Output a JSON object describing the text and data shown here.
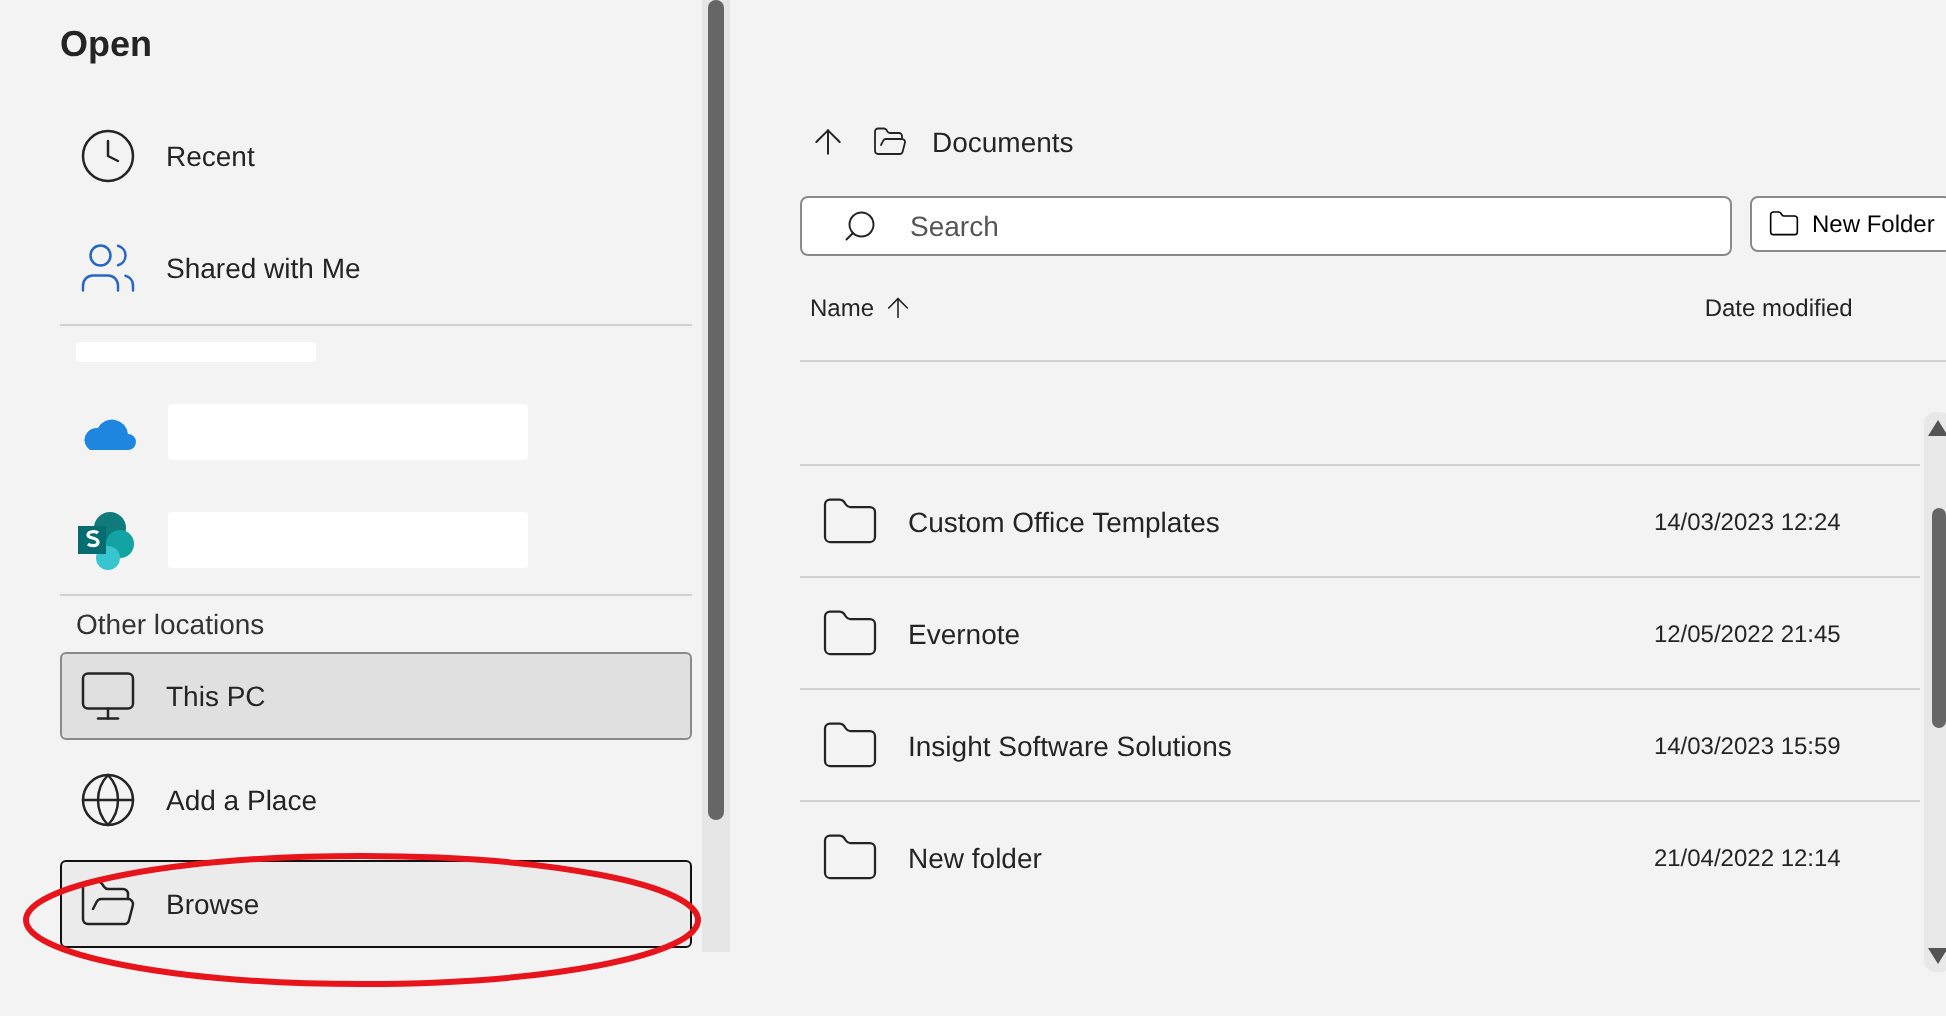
{
  "title": "Open",
  "nav": [
    {
      "kind": "place",
      "label": "Recent",
      "selected": false,
      "focused": false
    },
    {
      "kind": "place",
      "label": "Shared with Me",
      "selected": false,
      "focused": false
    },
    {
      "kind": "divider"
    },
    {
      "kind": "redacted-heading"
    },
    {
      "kind": "redacted-place"
    },
    {
      "kind": "redacted-place"
    },
    {
      "kind": "divider"
    },
    {
      "kind": "heading",
      "label": "Other locations"
    },
    {
      "kind": "place",
      "label": "This PC",
      "selected": true,
      "focused": false
    },
    {
      "kind": "place",
      "label": "Add a Place",
      "selected": false,
      "focused": false
    },
    {
      "kind": "place",
      "label": "Browse",
      "selected": false,
      "focused": true
    }
  ],
  "breadcrumb": {
    "folder": "Documents"
  },
  "search": {
    "placeholder": "Search"
  },
  "new_folder": {
    "label": "New Folder"
  },
  "columns": [
    {
      "label": "Name",
      "sorted": true
    },
    {
      "label": "Date modified",
      "sorted": false
    }
  ],
  "rows": [
    {
      "name": "Custom Office Templates",
      "modified": "14/03/2023 12:24"
    },
    {
      "name": "Evernote",
      "modified": "12/05/2022 21:45"
    },
    {
      "name": "Insight Software Solutions",
      "modified": "14/03/2023 15:59"
    },
    {
      "name": "New folder",
      "modified": "21/04/2022 12:14"
    }
  ],
  "annotation": {
    "kind": "ellipse",
    "color": "#e8141c"
  }
}
